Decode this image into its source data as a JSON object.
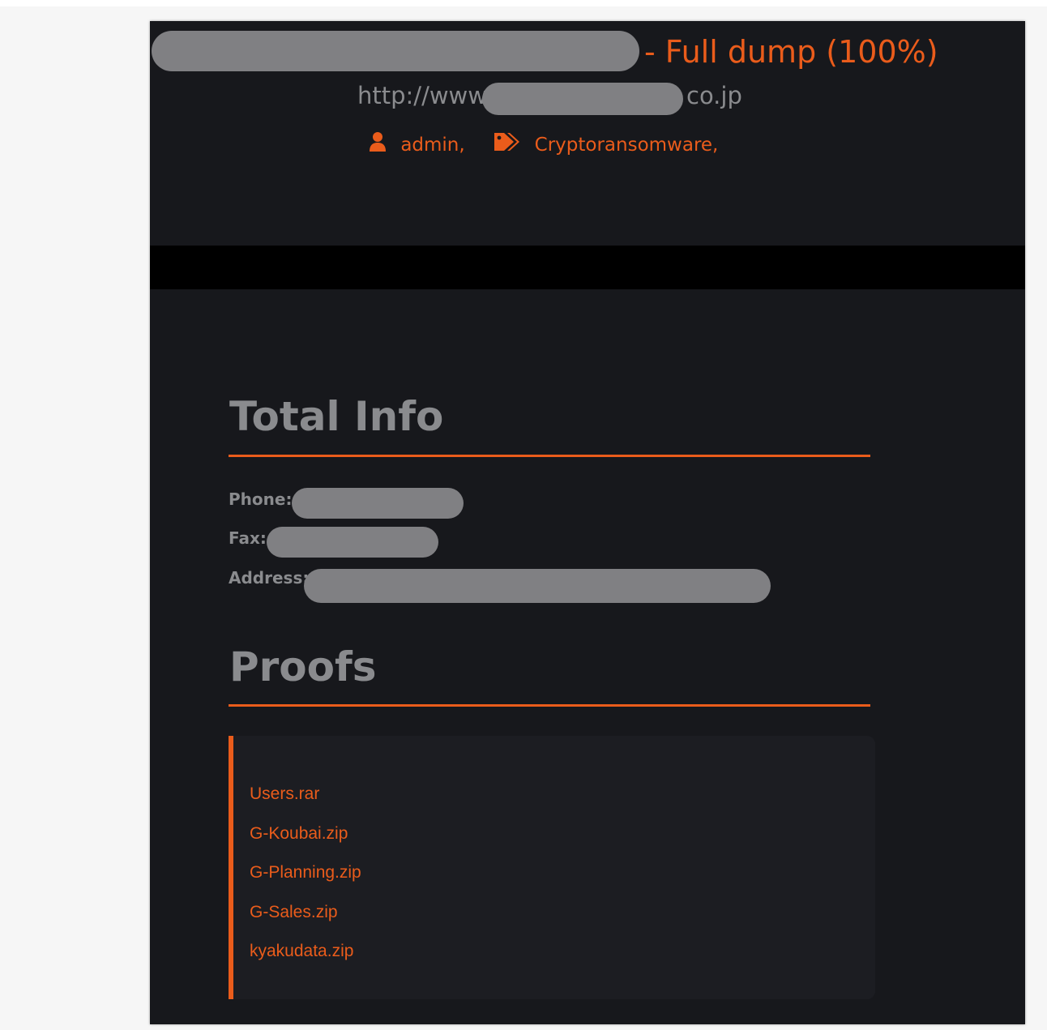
{
  "header": {
    "title_suffix": "- Full dump (100%)",
    "url_prefix": "http://www",
    "url_suffix": "co.jp",
    "author": "admin,",
    "tag": "Cryptoransomware,"
  },
  "colors": {
    "accent": "#ea5c1b",
    "page_bg": "#17181c",
    "muted_text": "#8a8b8e",
    "redaction": "#808083"
  },
  "icons": {
    "author": "user-icon",
    "tag": "tags-icon"
  },
  "total_info": {
    "heading": "Total Info",
    "phone_label": "Phone:",
    "fax_label": "Fax:",
    "address_label": "Address:"
  },
  "proofs": {
    "heading": "Proofs",
    "files": [
      "Users.rar",
      "G-Koubai.zip",
      "G-Planning.zip",
      "G-Sales.zip",
      "kyakudata.zip"
    ]
  }
}
